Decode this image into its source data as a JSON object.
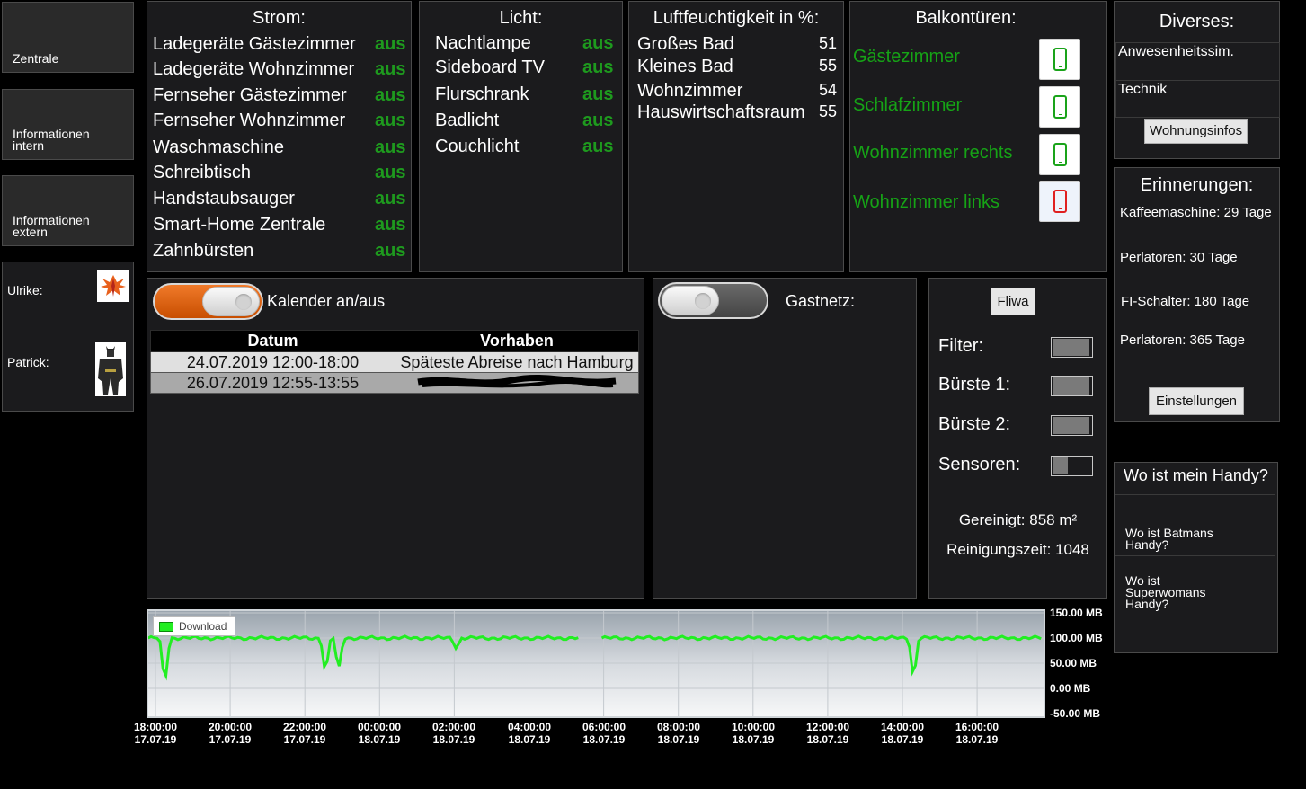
{
  "nav": {
    "zentrale": "Zentrale",
    "info_intern": "Informationen intern",
    "info_extern": "Informationen extern"
  },
  "persons": [
    {
      "name": "Ulrike:",
      "avatar": "phoenix-avatar"
    },
    {
      "name": "Patrick:",
      "avatar": "batman-avatar"
    }
  ],
  "strom": {
    "title": "Strom:",
    "items": [
      {
        "label": "Ladegeräte Gästezimmer",
        "state": "aus"
      },
      {
        "label": "Ladegeräte Wohnzimmer",
        "state": "aus"
      },
      {
        "label": "Fernseher Gästezimmer",
        "state": "aus"
      },
      {
        "label": "Fernseher Wohnzimmer",
        "state": "aus"
      },
      {
        "label": "Waschmaschine",
        "state": "aus"
      },
      {
        "label": "Schreibtisch",
        "state": "aus"
      },
      {
        "label": "Handstaubsauger",
        "state": "aus"
      },
      {
        "label": "Smart-Home Zentrale",
        "state": "aus"
      },
      {
        "label": "Zahnbürsten",
        "state": "aus"
      }
    ]
  },
  "licht": {
    "title": "Licht:",
    "items": [
      {
        "label": "Nachtlampe",
        "state": "aus"
      },
      {
        "label": "Sideboard TV",
        "state": "aus"
      },
      {
        "label": "Flurschrank",
        "state": "aus"
      },
      {
        "label": "Badlicht",
        "state": "aus"
      },
      {
        "label": "Couchlicht",
        "state": "aus"
      }
    ]
  },
  "humidity": {
    "title": "Luftfeuchtigkeit in %:",
    "items": [
      {
        "label": "Großes Bad",
        "value": "51"
      },
      {
        "label": "Kleines Bad",
        "value": "55"
      },
      {
        "label": "Wohnzimmer",
        "value": "54"
      },
      {
        "label": "Hauswirtschaftsraum",
        "value": "55"
      }
    ]
  },
  "doors": {
    "title": "Balkontüren:",
    "items": [
      {
        "label": "Gästezimmer",
        "state": "closed"
      },
      {
        "label": "Schlafzimmer",
        "state": "closed"
      },
      {
        "label": "Wohnzimmer rechts",
        "state": "closed"
      },
      {
        "label": "Wohnzimmer links",
        "state": "open"
      }
    ]
  },
  "diverses": {
    "title": "Diverses:",
    "items": [
      "Anwesenheitssim.",
      "Technik"
    ],
    "button": "Wohnungsinfos"
  },
  "calendar": {
    "toggle_label": "Kalender an/aus",
    "toggle_on": true,
    "headers": [
      "Datum",
      "Vorhaben"
    ],
    "rows": [
      {
        "date": "24.07.2019 12:00-18:00",
        "plan": "Späteste Abreise nach Hamburg"
      },
      {
        "date": "26.07.2019 12:55-13:55",
        "plan": ""
      }
    ]
  },
  "guestnet": {
    "label": "Gastnetz:",
    "toggle_on": false
  },
  "vacuum": {
    "button": "Fliwa",
    "items": [
      {
        "label": "Filter:",
        "level": 0.95
      },
      {
        "label": "Bürste 1:",
        "level": 0.95
      },
      {
        "label": "Bürste 2:",
        "level": 0.95
      },
      {
        "label": "Sensoren:",
        "level": 0.4
      }
    ],
    "cleaned": "Gereinigt: 858 m²",
    "cleaning_time": "Reinigungszeit: 1048"
  },
  "reminders": {
    "title": "Erinnerungen:",
    "items": [
      "Kaffeemaschine: 29 Tage",
      "Perlatoren: 30 Tage",
      "FI-Schalter: 180 Tage",
      "Perlatoren: 365 Tage"
    ],
    "button": "Einstellungen"
  },
  "phone": {
    "title": "Wo ist mein Handy?",
    "items": [
      "Wo ist Batmans Handy?",
      "Wo ist Superwomans Handy?"
    ]
  },
  "colors": {
    "status_green": "#1e9a1e",
    "door_closed": "#1aa31a",
    "door_open": "#e02020",
    "toggle_on": "#e8650a",
    "download_line": "#22ee22"
  },
  "chart_data": {
    "type": "line",
    "legend": "Download",
    "ylim": [
      -50,
      150
    ],
    "y_ticks": [
      "150.00 MB",
      "100.00 MB",
      "50.00 MB",
      "0.00 MB",
      "-50.00 MB"
    ],
    "x_ticks": [
      [
        "18:00:00",
        "17.07.19"
      ],
      [
        "20:00:00",
        "17.07.19"
      ],
      [
        "22:00:00",
        "17.07.19"
      ],
      [
        "00:00:00",
        "18.07.19"
      ],
      [
        "02:00:00",
        "18.07.19"
      ],
      [
        "04:00:00",
        "18.07.19"
      ],
      [
        "06:00:00",
        "18.07.19"
      ],
      [
        "08:00:00",
        "18.07.19"
      ],
      [
        "10:00:00",
        "18.07.19"
      ],
      [
        "12:00:00",
        "18.07.19"
      ],
      [
        "14:00:00",
        "18.07.19"
      ],
      [
        "16:00:00",
        "18.07.19"
      ]
    ],
    "series": [
      {
        "name": "Download",
        "baseline_mb": 100,
        "x_start_h": -0.2,
        "x_end_h": 23.75,
        "gaps_h": [
          [
            11.35,
            11.95
          ]
        ],
        "dips": [
          {
            "h": 0.25,
            "mb": 5
          },
          {
            "h": 4.55,
            "mb": 28
          },
          {
            "h": 4.9,
            "mb": 35
          },
          {
            "h": 8.05,
            "mb": 78
          },
          {
            "h": 20.3,
            "mb": 15
          }
        ]
      }
    ]
  }
}
